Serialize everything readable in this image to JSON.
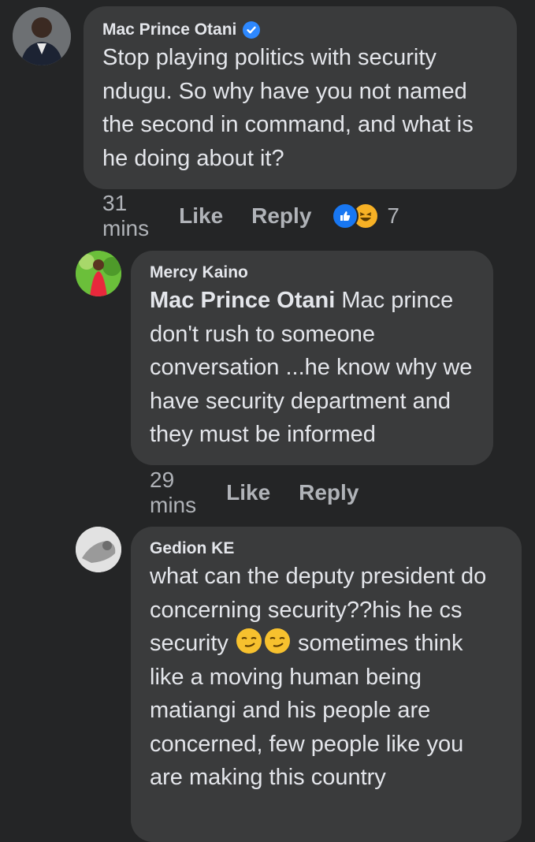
{
  "comments": [
    {
      "author": "Mac Prince Otani",
      "verified": true,
      "text": "Stop playing politics with security ndugu. So why have you not named the second in command, and what is he doing about it?",
      "time": "31 mins",
      "like": "Like",
      "reply": "Reply",
      "reaction_count": "7",
      "reactions": [
        "like-icon",
        "haha-icon"
      ]
    },
    {
      "author": "Mercy Kaino",
      "mention": "Mac Prince Otani",
      "text": " Mac prince don't rush to someone conversation ...he know why we have security department and they must be informed",
      "time": "29 mins",
      "like": "Like",
      "reply": "Reply"
    },
    {
      "author": "Gedion KE",
      "text_parts": [
        "what can the deputy president do  concerning security??his he cs security ",
        " sometimes think like a moving human being matiangi and his people are concerned, few people like you are making this country"
      ],
      "emojis": [
        "smirk-emoji",
        "smirk-emoji"
      ]
    }
  ]
}
